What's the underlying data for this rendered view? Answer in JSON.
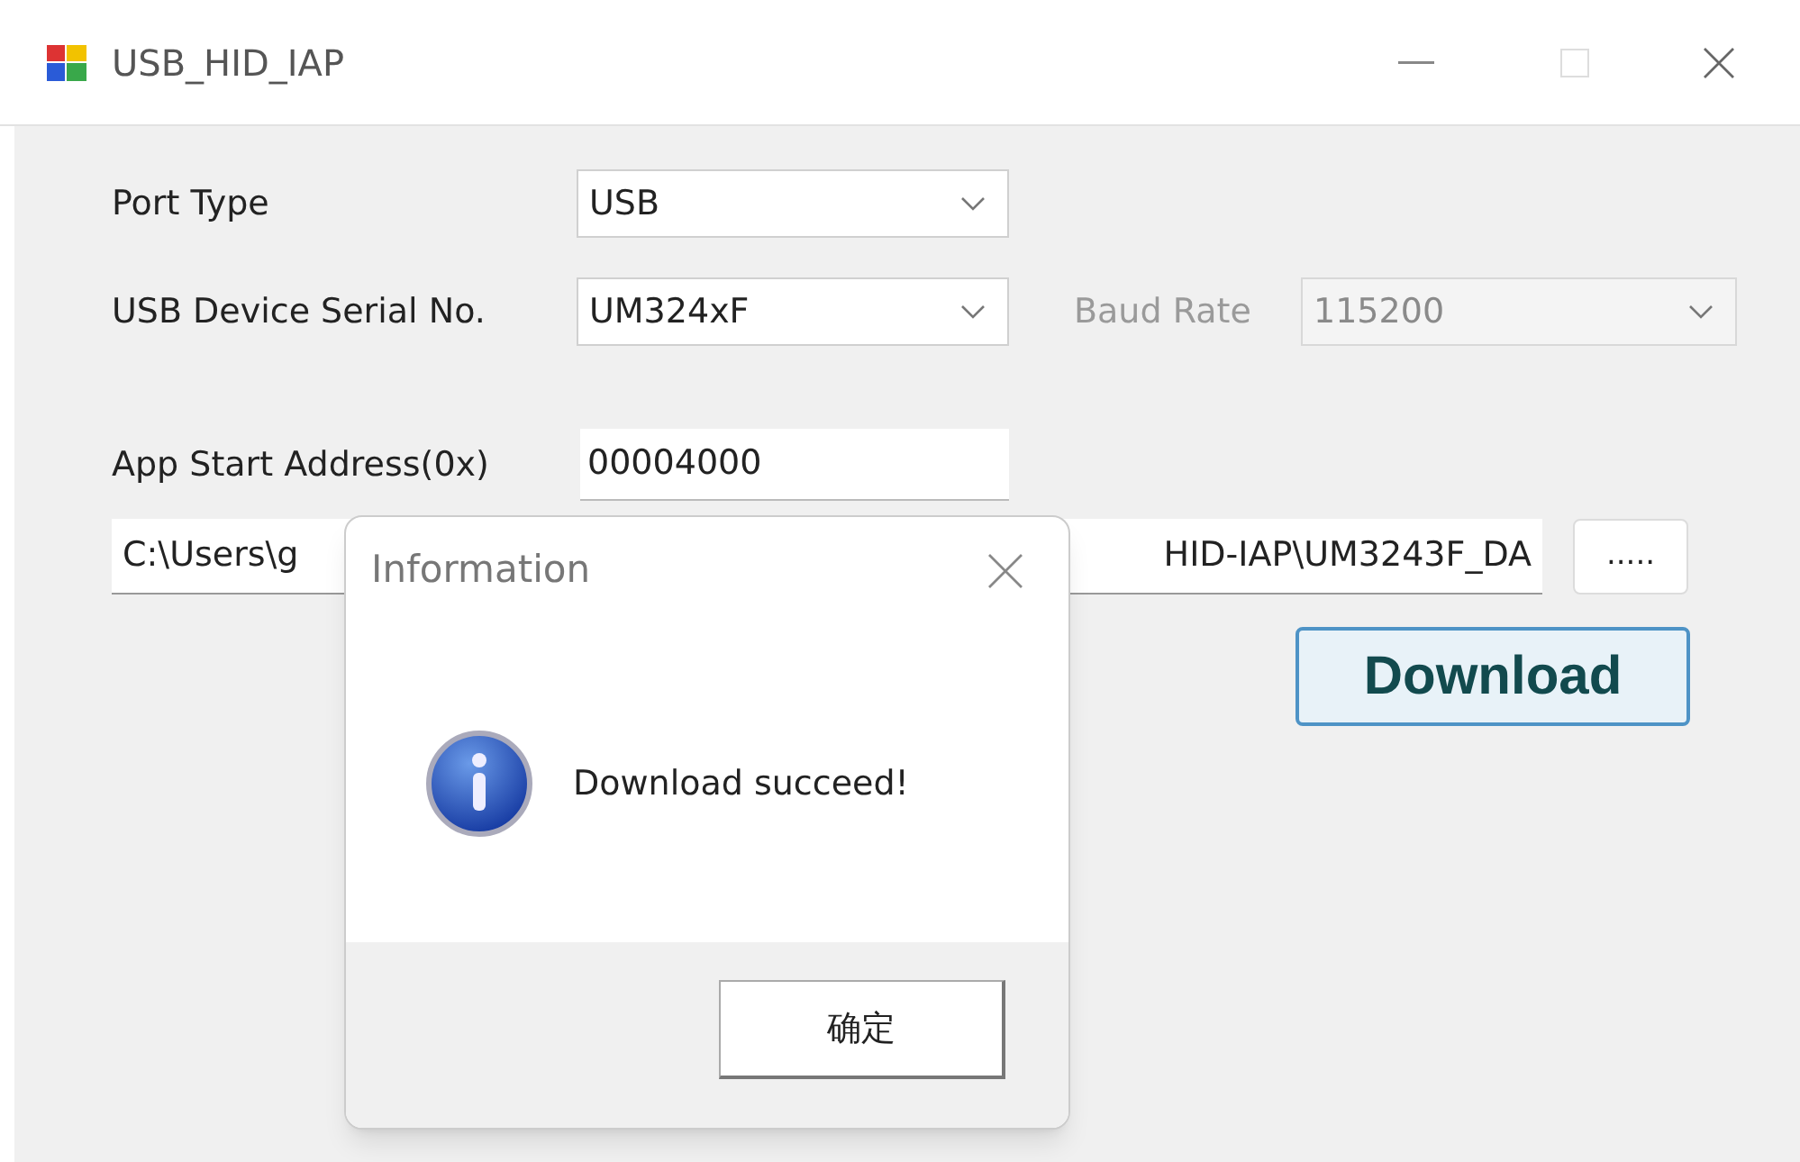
{
  "window": {
    "title": "USB_HID_IAP"
  },
  "form": {
    "port_type": {
      "label": "Port Type",
      "value": "USB"
    },
    "serial": {
      "label": "USB Device Serial No.",
      "value": "UM324xF"
    },
    "baud": {
      "label": "Baud Rate",
      "value": "115200",
      "disabled": true
    },
    "address": {
      "label": "App Start Address(0x)",
      "value": "00004000"
    },
    "path": {
      "value_left": "C:\\Users\\g",
      "value_right": "HID-IAP\\UM3243F_DA"
    },
    "browse_button": ".....",
    "download_button": "Download"
  },
  "dialog": {
    "title": "Information",
    "message": "Download succeed!",
    "ok_button": "确定"
  }
}
